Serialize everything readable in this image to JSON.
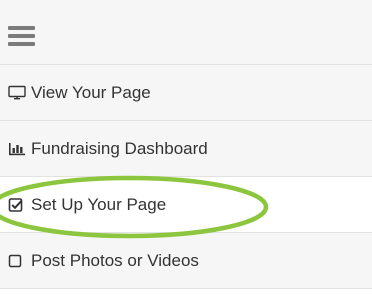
{
  "menu": {
    "toggle_icon": "hamburger-icon",
    "items": [
      {
        "label": "View Your Page",
        "icon": "monitor-icon",
        "active": false
      },
      {
        "label": "Fundraising Dashboard",
        "icon": "bar-chart-icon",
        "active": false
      },
      {
        "label": "Set Up Your Page",
        "icon": "checked-square-icon",
        "active": true
      },
      {
        "label": "Post Photos or Videos",
        "icon": "empty-square-icon",
        "active": false
      }
    ]
  },
  "colors": {
    "menu_background": "#f6f6f6",
    "active_background": "#ffffff",
    "divider": "#e2e2e2",
    "text": "#333333",
    "hamburger": "#7b7b7b",
    "highlight_annotation": "#8cc63f"
  }
}
